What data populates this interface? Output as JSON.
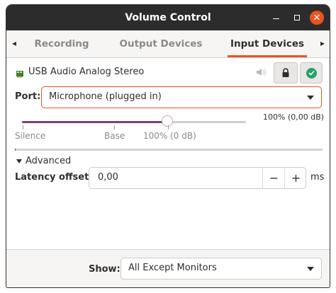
{
  "window": {
    "title": "Volume Control",
    "accent": "#e95420",
    "icons": {
      "minimize": "minimize-icon",
      "maximize": "maximize-icon",
      "close": "close-icon"
    }
  },
  "tabs": {
    "left_arrow": "◂",
    "right_arrow": "▸",
    "items": [
      {
        "label": "Recording",
        "active": false
      },
      {
        "label": "Output Devices",
        "active": false
      },
      {
        "label": "Input Devices",
        "active": true
      }
    ]
  },
  "device": {
    "name": "USB Audio Analog Stereo",
    "icon": "sound-card-icon",
    "mute_icon": "speaker-muted-icon",
    "lock_icon": "lock-icon",
    "default_icon": "check-circle-icon",
    "default_color": "#26a269"
  },
  "port": {
    "label": "Port:",
    "value": "Microphone (plugged in)"
  },
  "volume": {
    "readout": "100% (0,00 dB)",
    "level_fraction": 0.65,
    "tick_labels": [
      "Silence",
      "Base",
      "100% (0 dB)"
    ],
    "fill_color": "#7f3f74"
  },
  "peak_meter": {
    "level_fraction": 0.003
  },
  "advanced": {
    "label": "Advanced",
    "latency_label": "Latency offset:",
    "latency_value": "0,00",
    "minus": "−",
    "plus": "+",
    "unit": "ms"
  },
  "footer": {
    "show_label": "Show:",
    "show_value": "All Except Monitors"
  }
}
